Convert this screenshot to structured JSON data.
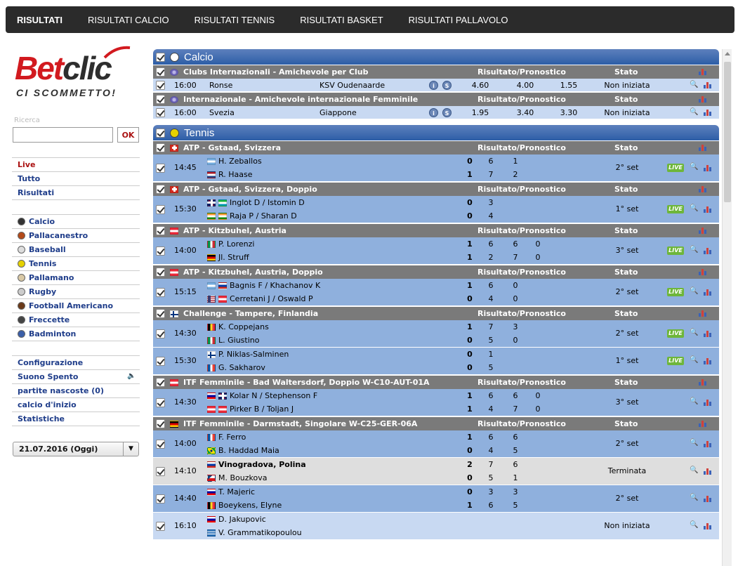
{
  "topnav": [
    "RISULTATI",
    "RISULTATI CALCIO",
    "RISULTATI TENNIS",
    "RISULTATI BASKET",
    "RISULTATI PALLAVOLO"
  ],
  "logo": {
    "brand_red": "Bet",
    "brand_dark": "clic",
    "tagline": "CI SCOMMETTO!"
  },
  "search": {
    "label": "Ricerca",
    "value": "",
    "button": "OK"
  },
  "nav1": [
    "Live",
    "Tutto",
    "Risultati"
  ],
  "sports_nav": [
    {
      "label": "Calcio",
      "icon": "soccer-ball-icon",
      "color": "#333"
    },
    {
      "label": "Pallacanestro",
      "icon": "basketball-icon",
      "color": "#b34a1a"
    },
    {
      "label": "Baseball",
      "icon": "baseball-icon",
      "color": "#ddd"
    },
    {
      "label": "Tennis",
      "icon": "tennis-ball-icon",
      "color": "#e6d200"
    },
    {
      "label": "Pallamano",
      "icon": "handball-icon",
      "color": "#d9c9a6"
    },
    {
      "label": "Rugby",
      "icon": "rugby-ball-icon",
      "color": "#ccc"
    },
    {
      "label": "Football Americano",
      "icon": "american-football-icon",
      "color": "#6b3a1a"
    },
    {
      "label": "Freccette",
      "icon": "darts-icon",
      "color": "#444"
    },
    {
      "label": "Badminton",
      "icon": "badminton-icon",
      "color": "#3b5fa8"
    }
  ],
  "nav3": [
    "Configurazione",
    "Suono Spento",
    "partite nascoste (0)",
    "calcio d'inizio",
    "Statistiche"
  ],
  "date_select": "21.07.2016  (Oggi)",
  "col_result": "Risultato/Pronostico",
  "col_status": "Stato",
  "live_label": "LIVE",
  "calcio": {
    "title": "Calcio",
    "comps": [
      {
        "name": "Clubs Internazionali - Amichevole per Club",
        "time": "16:00",
        "home": "Ronse",
        "away": "KSV Oudenaarde",
        "odds": [
          "4.60",
          "4.00",
          "1.55"
        ],
        "status": "Non iniziata"
      },
      {
        "name": "Internazionale - Amichevole internazionale Femminile",
        "time": "16:00",
        "home": "Svezia",
        "away": "Giappone",
        "odds": [
          "1.95",
          "3.40",
          "3.30"
        ],
        "status": "Non iniziata"
      }
    ]
  },
  "tennis": {
    "title": "Tennis",
    "comps": [
      {
        "name": "ATP - Gstaad, Svizzera",
        "flag": "ch",
        "matches": [
          {
            "time": "14:45",
            "p1": "H. Zeballos",
            "f1": [
              "ar"
            ],
            "p2": "R. Haase",
            "f2": [
              "nl"
            ],
            "s1": [
              "0",
              "6",
              "1"
            ],
            "s2": [
              "1",
              "7",
              "2"
            ],
            "status": "2° set",
            "live": true,
            "shade": "dark"
          }
        ]
      },
      {
        "name": "ATP - Gstaad, Svizzera, Doppio",
        "flag": "ch",
        "matches": [
          {
            "time": "15:30",
            "p1": "Inglot D / Istomin D",
            "f1": [
              "gb",
              "uz"
            ],
            "p2": "Raja P / Sharan D",
            "f2": [
              "in",
              "in"
            ],
            "s1": [
              "0",
              "3"
            ],
            "s2": [
              "0",
              "4"
            ],
            "status": "1° set",
            "live": true,
            "shade": "dark"
          }
        ]
      },
      {
        "name": "ATP - Kitzbuhel, Austria",
        "flag": "at",
        "matches": [
          {
            "time": "14:00",
            "p1": "P. Lorenzi",
            "f1": [
              "it"
            ],
            "p2": "Jl. Struff",
            "f2": [
              "de"
            ],
            "s1": [
              "1",
              "6",
              "6",
              "0"
            ],
            "s2": [
              "1",
              "2",
              "7",
              "0"
            ],
            "status": "3° set",
            "live": true,
            "shade": "dark"
          }
        ]
      },
      {
        "name": "ATP - Kitzbuhel, Austria, Doppio",
        "flag": "at",
        "matches": [
          {
            "time": "15:15",
            "p1": "Bagnis F / Khachanov K",
            "f1": [
              "ar",
              "ru"
            ],
            "p2": "Cerretani J / Oswald P",
            "f2": [
              "us",
              "at"
            ],
            "s1": [
              "1",
              "6",
              "0"
            ],
            "s2": [
              "0",
              "4",
              "0"
            ],
            "status": "2° set",
            "live": true,
            "shade": "dark"
          }
        ]
      },
      {
        "name": "Challenge - Tampere, Finlandia",
        "flag": "fi",
        "matches": [
          {
            "time": "14:30",
            "p1": "K. Coppejans",
            "f1": [
              "be"
            ],
            "p2": "L. Giustino",
            "f2": [
              "it"
            ],
            "s1": [
              "1",
              "7",
              "3"
            ],
            "s2": [
              "0",
              "5",
              "0"
            ],
            "status": "2° set",
            "live": true,
            "shade": "dark"
          },
          {
            "time": "15:30",
            "p1": "P. Niklas-Salminen",
            "f1": [
              "fi"
            ],
            "p2": "G. Sakharov",
            "f2": [
              "fr"
            ],
            "s1": [
              "0",
              "1"
            ],
            "s2": [
              "0",
              "5"
            ],
            "status": "1° set",
            "live": true,
            "shade": "dark"
          }
        ]
      },
      {
        "name": "ITF Femminile - Bad Waltersdorf, Doppio W-C10-AUT-01A",
        "flag": "at",
        "matches": [
          {
            "time": "14:30",
            "p1": "Kolar N / Stephenson F",
            "f1": [
              "si",
              "gb"
            ],
            "p2": "Pirker B / Toljan J",
            "f2": [
              "at",
              "at"
            ],
            "s1": [
              "1",
              "6",
              "6",
              "0"
            ],
            "s2": [
              "1",
              "4",
              "7",
              "0"
            ],
            "status": "3° set",
            "live": false,
            "shade": "dark"
          }
        ]
      },
      {
        "name": "ITF Femminile - Darmstadt, Singolare W-C25-GER-06A",
        "flag": "de",
        "matches": [
          {
            "time": "14:00",
            "p1": "F. Ferro",
            "f1": [
              "fr"
            ],
            "p2": "B. Haddad Maia",
            "f2": [
              "br"
            ],
            "s1": [
              "1",
              "6",
              "6"
            ],
            "s2": [
              "0",
              "4",
              "5"
            ],
            "status": "2° set",
            "live": false,
            "shade": "dark"
          },
          {
            "time": "14:10",
            "p1": "Vinogradova, Polina",
            "f1": [
              "ru"
            ],
            "p2": "M. Bouzkova",
            "f2": [
              "cz"
            ],
            "s1": [
              "2",
              "7",
              "6"
            ],
            "s2": [
              "0",
              "5",
              "1"
            ],
            "status": "Terminata",
            "live": false,
            "shade": "fin",
            "bold1": true
          },
          {
            "time": "14:40",
            "p1": "T. Majeric",
            "f1": [
              "si"
            ],
            "p2": "Boeykens, Elyne",
            "f2": [
              "be"
            ],
            "s1": [
              "0",
              "3",
              "3"
            ],
            "s2": [
              "1",
              "6",
              "5"
            ],
            "status": "2° set",
            "live": false,
            "shade": "dark"
          },
          {
            "time": "16:10",
            "p1": "D. Jakupovic",
            "f1": [
              "si"
            ],
            "p2": "V. Grammatikopoulou",
            "f2": [
              "gr"
            ],
            "s1": [],
            "s2": [],
            "status": "Non iniziata",
            "live": false,
            "shade": "light"
          }
        ]
      }
    ]
  }
}
